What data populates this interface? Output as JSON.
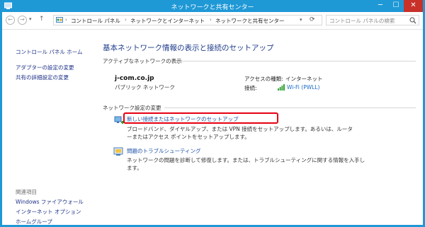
{
  "window": {
    "title": "ネットワークと共有センター",
    "controls": {
      "minimize": "─",
      "maximize": "☐",
      "close": "✕"
    }
  },
  "nav": {
    "back": "←",
    "forward": "→",
    "recent": "▾",
    "up": "↑",
    "crumb_sep": "›",
    "breadcrumbs": [
      "コントロール パネル",
      "ネットワークとインターネット",
      "ネットワークと共有センター"
    ],
    "address_dropdown": "▾",
    "refresh": "⟳",
    "search_placeholder": "コントロール パネルの検索"
  },
  "sidebar": {
    "home": "コントロール パネル ホーム",
    "links": [
      "アダプターの設定の変更",
      "共有の詳細設定の変更"
    ],
    "related_heading": "関連項目",
    "related": [
      "Windows ファイアウォール",
      "インターネット オプション",
      "ホームグループ"
    ]
  },
  "main": {
    "title": "基本ネットワーク情報の表示と接続のセットアップ",
    "active_label": "アクティブなネットワークの表示",
    "network": {
      "name": "j-com.co.jp",
      "type": "パブリック ネットワーク",
      "access_label": "アクセスの種類:",
      "access_value": "インターネット",
      "conn_label": "接続:",
      "conn_value": "Wi-Fi (PWLL)"
    },
    "change_label": "ネットワーク設定の変更",
    "tasks": [
      {
        "link": "新しい接続またはネットワークのセットアップ",
        "desc": "ブロードバンド、ダイヤルアップ、または VPN 接続をセットアップします。あるいは、ルーターまたはアクセス ポイントをセットアップします。"
      },
      {
        "link": "問題のトラブルシューティング",
        "desc": "ネットワークの問題を診断して修復します。または、トラブルシューティングに関する情報を入手します。"
      }
    ]
  },
  "colors": {
    "frame": "#1f98d6",
    "link": "#1a6bc4",
    "highlight": "#e60012"
  }
}
